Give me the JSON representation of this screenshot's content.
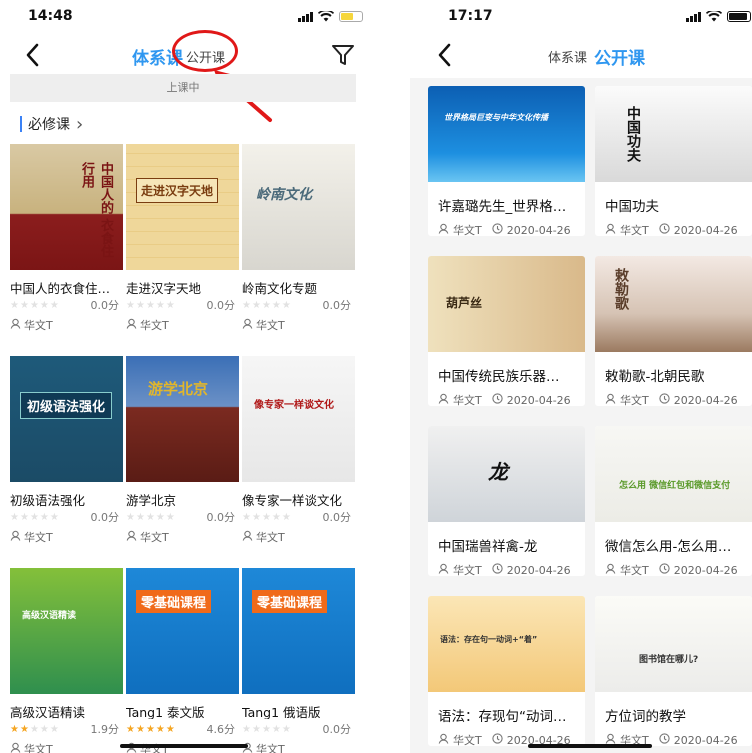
{
  "left": {
    "time": "14:48",
    "tabs": {
      "system": "体系课",
      "public": "公开课"
    },
    "subbar": "上课中",
    "section": {
      "title": "必修课",
      "arrow": "›"
    },
    "courses": [
      {
        "title": "中国人的衣食住…",
        "stars": "★★★★★",
        "score": "0.0分",
        "teacher": "华文T",
        "thumb_text": "中国人的 衣食住行用"
      },
      {
        "title": "走进汉字天地",
        "stars": "★★★★★",
        "score": "0.0分",
        "teacher": "华文T",
        "thumb_text": "走进汉字天地"
      },
      {
        "title": "岭南文化专题",
        "stars": "★★★★★",
        "score": "0.0分",
        "teacher": "华文T",
        "thumb_text": "岭南文化"
      },
      {
        "title": "初级语法强化",
        "stars": "★★★★★",
        "score": "0.0分",
        "teacher": "华文T",
        "thumb_text": "初级语法强化"
      },
      {
        "title": "游学北京",
        "stars": "★★★★★",
        "score": "0.0分",
        "teacher": "华文T",
        "thumb_text": "游学北京"
      },
      {
        "title": "像专家一样谈文化",
        "stars": "★★★★★",
        "score": "0.0分",
        "teacher": "华文T",
        "thumb_text": "像专家一样谈文化"
      },
      {
        "title": "高级汉语精读",
        "stars": "★★★★★",
        "score": "1.9分",
        "teacher": "华文T",
        "rating": 2,
        "thumb_text": "高级汉语精读"
      },
      {
        "title": "Tang1 泰文版",
        "stars": "★★★★★",
        "score": "4.6分",
        "teacher": "华文T",
        "rating": 5,
        "thumb_text": "零基础课程"
      },
      {
        "title": "Tang1 俄语版",
        "stars": "★★★★★",
        "score": "0.0分",
        "teacher": "华文T",
        "thumb_text": "零基础课程"
      }
    ]
  },
  "right": {
    "time": "17:17",
    "tabs": {
      "system": "体系课",
      "public": "公开课"
    },
    "courses": [
      {
        "title": "许嘉璐先生_世界格…",
        "teacher": "华文T",
        "date": "2020-04-26",
        "thumb_text": "世界格局巨变与中华文化传播"
      },
      {
        "title": "中国功夫",
        "teacher": "华文T",
        "date": "2020-04-26",
        "thumb_text": "中国功夫"
      },
      {
        "title": "中国传统民族乐器…",
        "teacher": "华文T",
        "date": "2020-04-26",
        "thumb_text": "葫芦丝"
      },
      {
        "title": "敕勒歌-北朝民歌",
        "teacher": "华文T",
        "date": "2020-04-26",
        "thumb_text": "敕勒歌"
      },
      {
        "title": "中国瑞兽祥禽-龙",
        "teacher": "华文T",
        "date": "2020-04-26",
        "thumb_text": "龙"
      },
      {
        "title": "微信怎么用-怎么用…",
        "teacher": "华文T",
        "date": "2020-04-26",
        "thumb_text": "怎么用 微信红包和微信支付"
      },
      {
        "title": "语法：存现句“动词…",
        "teacher": "华文T",
        "date": "2020-04-26",
        "thumb_text": "语法：存在句一动词+“着”"
      },
      {
        "title": "方位词的教学",
        "teacher": "华文T",
        "date": "2020-04-26",
        "thumb_text": "图书馆在哪儿?"
      }
    ]
  },
  "colors": {
    "accent": "#2f97f0",
    "annotation": "#e01818",
    "star_on": "#f5a623",
    "star_off": "#e2e2e2"
  }
}
